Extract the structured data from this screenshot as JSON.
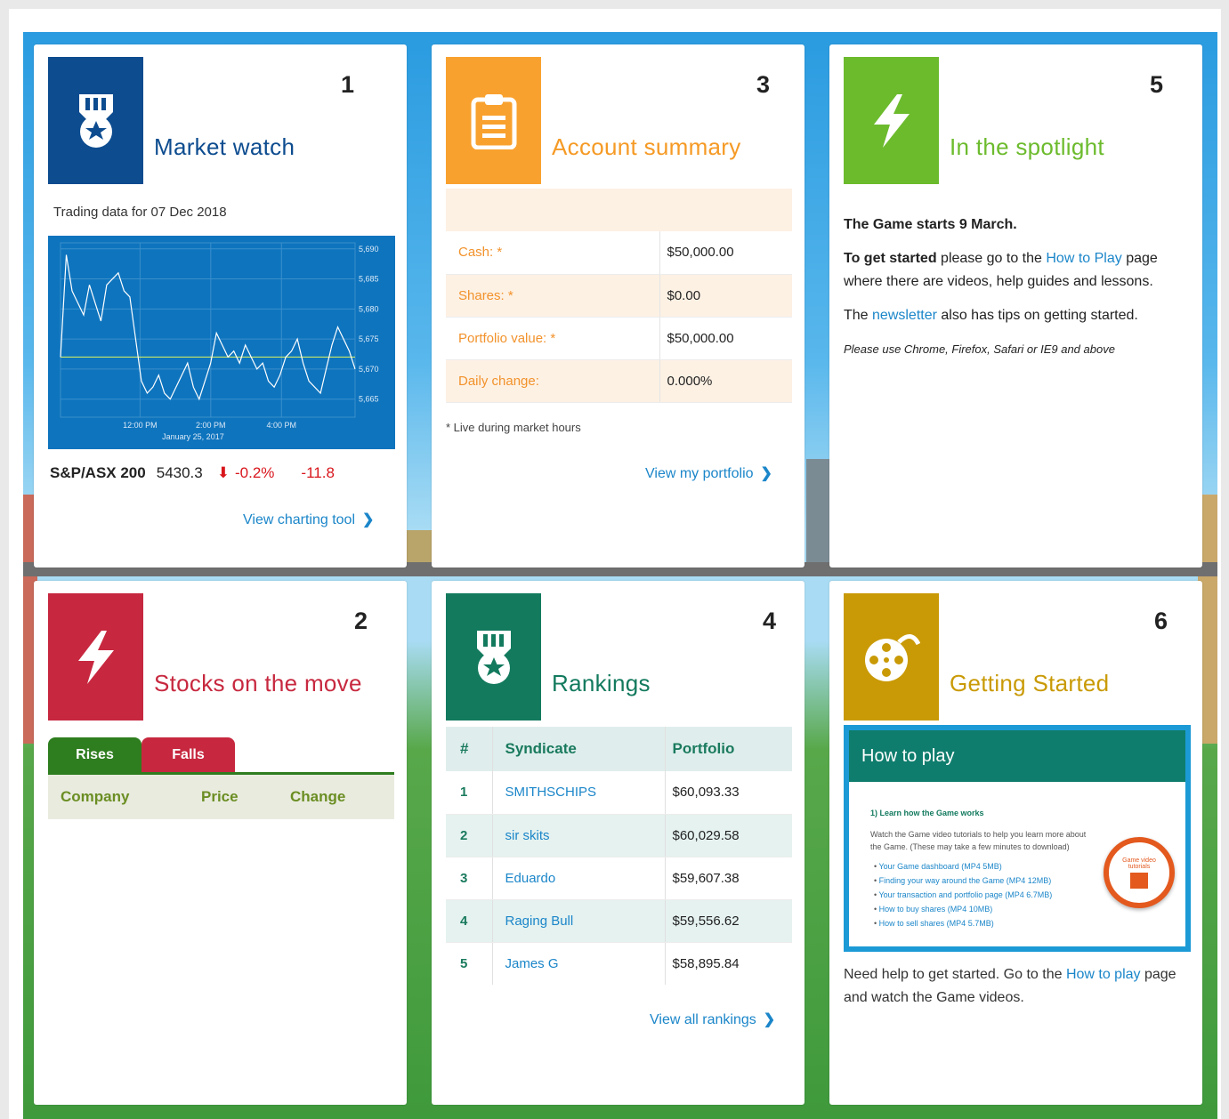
{
  "cards": {
    "market_watch": {
      "number": "1",
      "title": "Market watch",
      "trading_date": "Trading data for 07 Dec 2018",
      "chart_data": {
        "type": "line",
        "title": "",
        "x_ticks": [
          "12:00 PM",
          "2:00 PM",
          "4:00 PM"
        ],
        "x_caption": "January 25, 2017",
        "y_ticks": [
          "5,690",
          "5,685",
          "5,680",
          "5,675",
          "5,670",
          "5,665"
        ],
        "ylim": [
          5662,
          5691
        ],
        "reference_line": 5672,
        "series": [
          {
            "values": [
              5672,
              5689,
              5683,
              5681,
              5679,
              5684,
              5681,
              5678,
              5684,
              5685,
              5686,
              5683,
              5682,
              5675,
              5668,
              5666,
              5667,
              5669,
              5666,
              5665,
              5667,
              5669,
              5671,
              5667,
              5665,
              5668,
              5671,
              5676,
              5674,
              5672,
              5673,
              5671,
              5674,
              5672,
              5670,
              5671,
              5668,
              5667,
              5669,
              5672,
              5673,
              5675,
              5671,
              5668,
              5667,
              5666,
              5670,
              5674,
              5677,
              5675,
              5673,
              5670
            ]
          }
        ],
        "colors": {
          "background": "#0e74be",
          "line": "#ffffff",
          "reference": "#c8e86a",
          "grid": "#3b8fcb"
        }
      },
      "index": {
        "name": "S&P/ASX 200",
        "value": "5430.3",
        "arrow": "⬇",
        "pct": "-0.2%",
        "change": "-11.8"
      },
      "link": "View charting tool",
      "color": "#0d4c8f"
    },
    "stocks": {
      "number": "2",
      "title": "Stocks on the move",
      "tabs": [
        "Rises",
        "Falls"
      ],
      "columns": [
        "Company",
        "Price",
        "Change"
      ],
      "color": "#c7283f"
    },
    "account": {
      "number": "3",
      "title": "Account summary",
      "rows": [
        {
          "label": "Cash: *",
          "value": "$50,000.00"
        },
        {
          "label": "Shares: *",
          "value": "$0.00"
        },
        {
          "label": "Portfolio value: *",
          "value": "$50,000.00"
        },
        {
          "label": "Daily change:",
          "value": "0.000%"
        }
      ],
      "note": "* Live during market hours",
      "link": "View my portfolio",
      "color": "#f9a12e"
    },
    "rankings": {
      "number": "4",
      "title": "Rankings",
      "columns": [
        "#",
        "Syndicate",
        "Portfolio"
      ],
      "rows": [
        {
          "rank": "1",
          "syndicate": "SMITHSCHIPS",
          "portfolio": "$60,093.33"
        },
        {
          "rank": "2",
          "syndicate": "sir skits",
          "portfolio": "$60,029.58"
        },
        {
          "rank": "3",
          "syndicate": "Eduardo",
          "portfolio": "$59,607.38"
        },
        {
          "rank": "4",
          "syndicate": "Raging Bull",
          "portfolio": "$59,556.62"
        },
        {
          "rank": "5",
          "syndicate": "James G",
          "portfolio": "$58,895.84"
        }
      ],
      "link": "View all rankings",
      "color": "#137a5e"
    },
    "spotlight": {
      "number": "5",
      "title": "In the spotlight",
      "line1": "The Game starts 9 March.",
      "p2_bold": "To get started",
      "p2_a": " please go to the ",
      "p2_link": "How to Play",
      "p2_b": " page where there are videos, help guides and lessons.",
      "p3_a": "The ",
      "p3_link": "newsletter",
      "p3_b": " also has tips on getting started.",
      "p4": "Please use Chrome, Firefox, Safari or IE9 and above",
      "color": "#6cbb2d"
    },
    "getting_started": {
      "number": "6",
      "title": "Getting Started",
      "video_title": "How to play",
      "video_heading": "1) Learn how the Game works",
      "video_text": "Watch the Game video tutorials to help you learn more about the Game. (These may take a few minutes to download)",
      "video_items": [
        "Your Game dashboard (MP4 5MB)",
        "Finding your way around the Game (MP4 12MB)",
        "Your transaction and portfolio page (MP4 6.7MB)",
        "How to buy shares (MP4 10MB)",
        "How to sell shares (MP4 5.7MB)"
      ],
      "badge": "Game video tutorials",
      "help_a": "Need help to get started. Go to the ",
      "help_link": "How to play",
      "help_b": " page and watch the Game videos.",
      "color": "#c99a06"
    }
  }
}
